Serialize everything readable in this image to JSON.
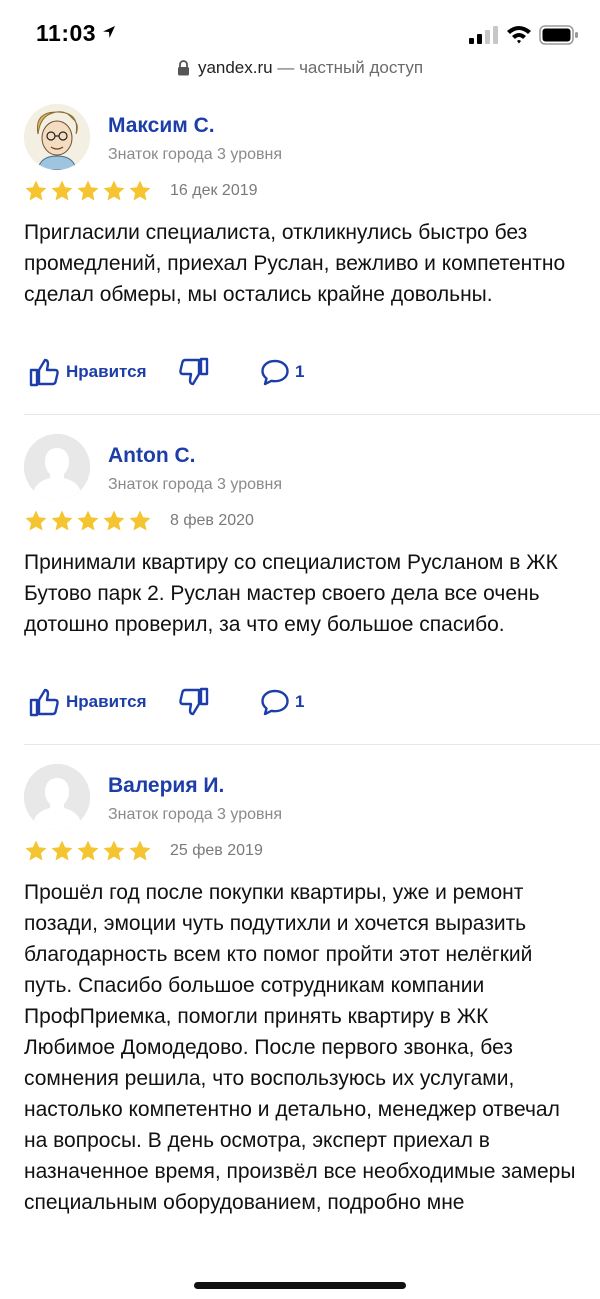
{
  "status_bar": {
    "time": "11:03"
  },
  "url_bar": {
    "domain": "yandex.ru",
    "suffix": "— частный доступ"
  },
  "reviews": [
    {
      "name": "Максим С.",
      "level": "Знаток города 3 уровня",
      "rating": 5,
      "date": "16 дек 2019",
      "text": "Пригласили специалиста, откликнулись быстро без промедлений, приехал Руслан, вежливо и компетентно сделал обмеры, мы остались крайне довольны.",
      "like_label": "Нравится",
      "comment_count": "1"
    },
    {
      "name": "Anton C.",
      "level": "Знаток города 3 уровня",
      "rating": 5,
      "date": "8 фев 2020",
      "text": "Принимали квартиру со специалистом Русланом в ЖК Бутово парк 2. Руслан мастер своего дела все очень дотошно проверил, за что ему большое спасибо.",
      "like_label": "Нравится",
      "comment_count": "1"
    },
    {
      "name": "Валерия И.",
      "level": "Знаток города 3 уровня",
      "rating": 5,
      "date": "25 фев 2019",
      "text": "Прошёл год после покупки квартиры, уже и ремонт позади, эмоции чуть подутихли и хочется выразить благодарность всем кто помог пройти этот нелёгкий путь. Спасибо большое сотрудникам компании ПрофПриемка, помогли принять квартиру в ЖК Любимое Домодедово. После первого звонка, без сомнения решила, что воспользуюсь их услугами, настолько компетентно и детально, менеджер отвечал на вопросы. В день осмотра, эксперт приехал в назначенное время, произвёл все необходимые замеры специальным оборудованием, подробно мне"
    }
  ],
  "colors": {
    "link": "#1d3ea8",
    "star": "#f4c531",
    "muted": "#8a8a8a"
  }
}
